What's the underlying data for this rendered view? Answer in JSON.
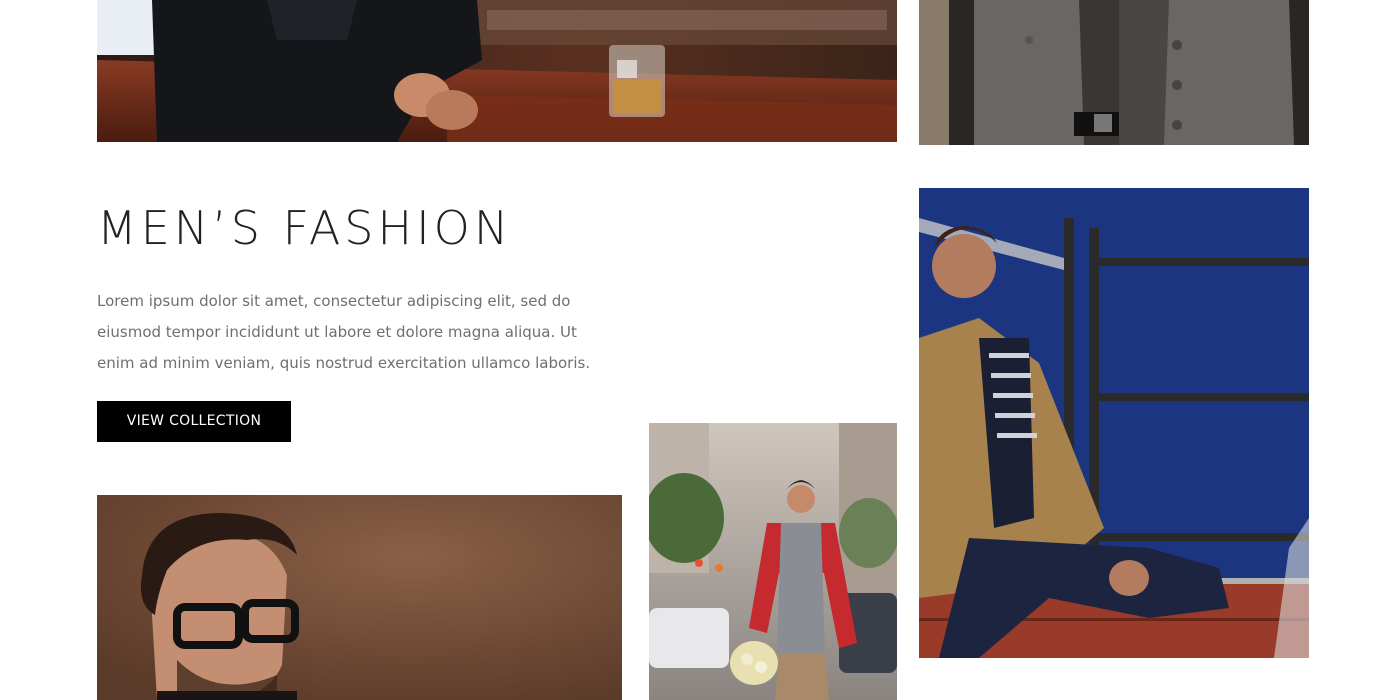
{
  "section": {
    "heading": "MEN’S FASHION",
    "body_lines": [
      "Lorem ipsum dolor sit amet, consectetur adipiscing elit, sed do",
      "eiusmod tempor incididunt ut labore et dolore magna aliqua. Ut",
      "enim ad minim veniam, quis nostrud exercitation ullamco laboris."
    ],
    "cta_label": "VIEW COLLECTION"
  },
  "colors": {
    "background": "#ffffff",
    "heading": "#222222",
    "body_text": "#6f6f6f",
    "button_bg": "#000000",
    "button_text": "#ffffff"
  }
}
